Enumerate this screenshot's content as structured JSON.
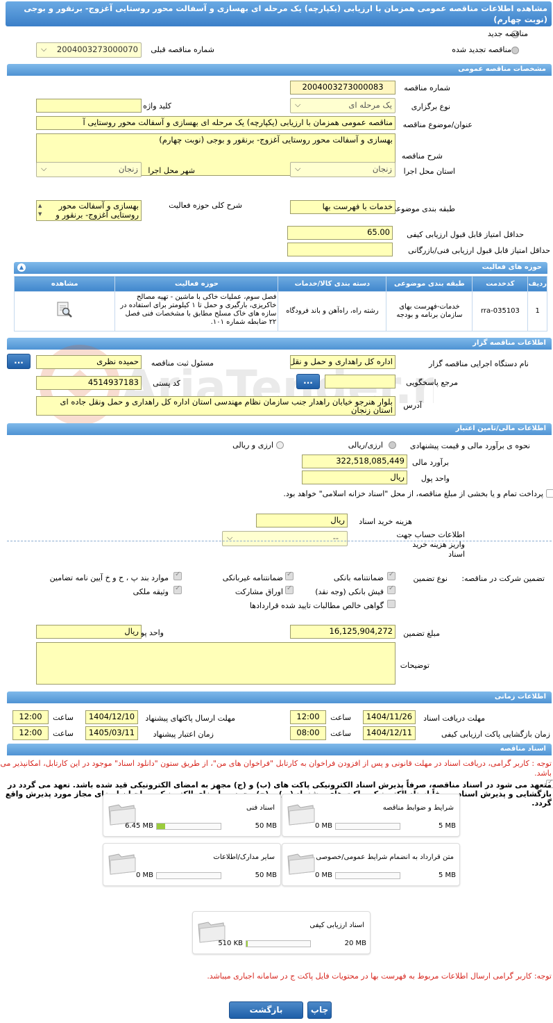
{
  "title": "مشاهده اطلاعات مناقصه عمومی همزمان با ارزیابی (یکپارچه) یک مرحله ای بهسازی و آسفالت محور روستایی آغزوج- برنقور و بوجی (نوبت چهارم)",
  "top": {
    "new_tender": "مناقصه جدید",
    "renewed_tender": "مناقصه تجدید شده",
    "prev_number_label": "شماره مناقصه قبلی",
    "prev_number": "2004003273000070"
  },
  "general": {
    "header": "مشخصات مناقصه عمومی",
    "number_label": "شماره مناقصه",
    "number": "2004003273000083",
    "type_label": "نوع برگزاری",
    "type": "یک مرحله ای",
    "keyword_label": "کلید واژه",
    "keyword": "",
    "subject_label": "عنوان/موضوع مناقصه",
    "subject": "مناقصه عمومی همزمان با ارزیابی (یکپارچه) یک مرحله ای بهسازی و آسفالت محور روستایی آ",
    "desc_label": "شرح مناقصه",
    "desc": "بهسازی و آسفالت محور روستایی آغزوج- برنقور و بوجی (نوبت چهارم)",
    "province_label": "استان محل اجرا",
    "province": "زنجان",
    "city_label": "شهر محل اجرا",
    "city": "زنجان",
    "category_label": "طبقه بندی موضوعی",
    "category": "خدمات با فهرست بها",
    "scope_label": "شرح کلی حوزه فعالیت",
    "scope": "بهسازی و آسفالت محور روستایی آغزوج- برنقور و",
    "quality_min_label": "حداقل امتیاز قابل قبول ارزیابی کیفی",
    "quality_min": "65.00",
    "tech_min_label": "حداقل امتیاز قابل قبول ارزیابی فنی/بازرگانی",
    "tech_min": ""
  },
  "activities": {
    "header": "حوزه های فعالیت",
    "columns": [
      "ردیف",
      "کدخدمت",
      "طبقه بندی موضوعی",
      "دسته بندی کالا/خدمات",
      "حوزه فعالیت",
      "مشاهده"
    ],
    "row": {
      "index": "1",
      "code": "rra-035103",
      "category": "خدمات-فهرست بهای سازمان برنامه و بودجه",
      "group": "رشته راه، راه‌آهن و باند فرودگاه",
      "activity": "فصل سوم، عملیات خاکی با ماشین - تهیه مصالح خاکریزی، بارگیری و حمل تا ۱ کیلومتر برای استفاده در سازه های خاک مسلح مطابق با مشخصات فنی فصل ۲۲ ضابطه شماره ۱۰۱."
    }
  },
  "organizer": {
    "header": "اطلاعات مناقصه گزار",
    "org_label": "نام دستگاه اجرایی مناقصه گزار",
    "org": "اداره کل راهداری و حمل و نقل",
    "officer_label": "مسئول ثبت مناقصه",
    "officer": "حمیده نظری",
    "ref_label": "مرجع پاسخگویی",
    "ref": "",
    "postal_label": "کد پستی",
    "postal": "4514937183",
    "address_label": "آدرس",
    "address": "بلوار هنرجو خیابان راهدار جنب سازمان نظام مهندسی استان اداره کل راهداری و حمل ونقل جاده ای استان زنجان",
    "btn": "..."
  },
  "finance": {
    "header": "اطلاعات مالی/تامین اعتبار",
    "method_label": "نحوه ی برآورد مالی و قیمت پیشنهادی",
    "opt1": "ارزی/ریالی",
    "opt2": "ارزی و ریالی",
    "estimate_label": "برآورد مالی",
    "estimate": "322,518,085,449",
    "unit_label": "واحد پول",
    "unit": "ریال",
    "treasury_text": "پرداخت تمام و یا بخشی از مبلغ مناقصه، از محل \"اسناد خزانه اسلامی\" خواهد بود.",
    "doc_cost_label": "هزینه خرید اسناد",
    "doc_cost": "ریال",
    "account_label": "اطلاعات حساب جهت واریز هزینه خرید اسناد",
    "account": "--"
  },
  "guarantee": {
    "label": "تضمین شرکت در مناقصه:",
    "type_label": "نوع تضمین",
    "items": {
      "bank": "ضمانتنامه بانکی",
      "nonbank": "ضمانتنامه غیربانکی",
      "bylaw": "موارد بند پ ، ح و خ آیین نامه تضامین",
      "cash": "فیش بانکی (وجه نقد)",
      "bonds": "اوراق مشارکت",
      "property": "وثیقه ملکی",
      "claims": "گواهی خالص مطالبات تایید شده قراردادها"
    },
    "amount_label": "مبلغ تضمین",
    "amount": "16,125,904,272",
    "unit_label": "واحد پول",
    "unit": "ریال",
    "notes_label": "توضیحات",
    "notes": ""
  },
  "timing": {
    "header": "اطلاعات زمانی",
    "doc_receive_label": "مهلت دریافت اسناد",
    "doc_receive_date": "1404/11/26",
    "doc_receive_time": "12:00",
    "submit_label": "مهلت ارسال پاکتهای پیشنهاد",
    "submit_date": "1404/12/10",
    "submit_time": "12:00",
    "open_label": "زمان بازگشایی پاکت ارزیابی کیفی",
    "open_date": "1404/12/11",
    "open_time": "08:00",
    "validity_label": "زمان اعتبار پیشنهاد",
    "validity_date": "1405/03/11",
    "validity_time": "12:00",
    "time_label": "ساعت"
  },
  "documents": {
    "header": "اسناد مناقصه",
    "notice": "توجه : کاربر گرامی، دریافت اسناد در مهلت قانونی و پس از افزودن فراخوان به کارتابل \"فراخوان های من\"، از طریق ستون \"دانلود اسناد\" موجود در این کارتابل، امکانپذیر می باشد.",
    "commit": "متعهد می شود در اسناد مناقصه، صرفاً پذیرش اسناد الکترونیکی پاکت های (ب) و (ج) مجهز به امضای الکترونیکی قید شده باشد. تعهد می گردد در بازگشایی و پذیرش اسناد، صرفاً اسناد الکترونیکی پاکت های پیشنهاد (ب) و (ج) مجهز به امضای الکترونیکی صاحبان امضای مجاز مورد پذیرش واقع گردد.",
    "cards": [
      {
        "name": "شرایط و ضوابط مناقصه",
        "used": "0 MB",
        "max": "5 MB",
        "pct": 0
      },
      {
        "name": "اسناد فنی",
        "used": "6.45 MB",
        "max": "50 MB",
        "pct": 13
      },
      {
        "name": "متن قرارداد به انضمام شرایط عمومی/خصوصی",
        "used": "0 MB",
        "max": "5 MB",
        "pct": 0
      },
      {
        "name": "سایر مدارک/اطلاعات",
        "used": "0 MB",
        "max": "50 MB",
        "pct": 0
      },
      {
        "name": "اسناد ارزیابی کیفی",
        "used": "510 KB",
        "max": "20 MB",
        "pct": 2.5
      }
    ],
    "footer_notice": "توجه: کاربر گرامی ارسال اطلاعات مربوط به فهرست بها در محتویات فایل پاکت ج در سامانه اجباری میباشد."
  },
  "actions": {
    "back": "بازگشت",
    "print": "چاپ"
  }
}
